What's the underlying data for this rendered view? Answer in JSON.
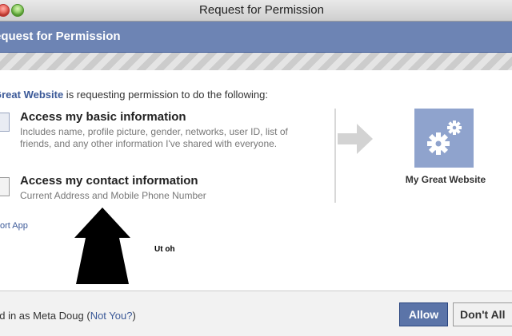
{
  "window": {
    "title": "Request for Permission"
  },
  "dialog": {
    "header": "equest for Permission",
    "intro_site": "Great Website",
    "intro_rest": " is requesting permission to do the following:"
  },
  "permissions": [
    {
      "title": "Access my basic information",
      "description": "Includes name, profile picture, gender, networks, user ID, list of friends, and any other information I've shared with everyone.",
      "icon": "profile-icon"
    },
    {
      "title": "Access my contact information",
      "description": "Current Address and Mobile Phone Number",
      "icon": "contact-card-icon"
    }
  ],
  "report_link": "ort App",
  "app": {
    "name": "My Great Website",
    "icon": "gears-icon",
    "icon_color": "#8fa3cd"
  },
  "annotation": {
    "text": "Ut oh",
    "icon": "up-arrow-icon"
  },
  "footer": {
    "logged_prefix": "ed in as Meta Doug (",
    "not_you": "Not You?",
    "logged_suffix": ")",
    "allow_label": "Allow",
    "deny_label": "Don't All"
  },
  "colors": {
    "facebook_blue": "#3b5998",
    "header_bg": "#6d84b4",
    "allow_button": "#5b74a8"
  }
}
